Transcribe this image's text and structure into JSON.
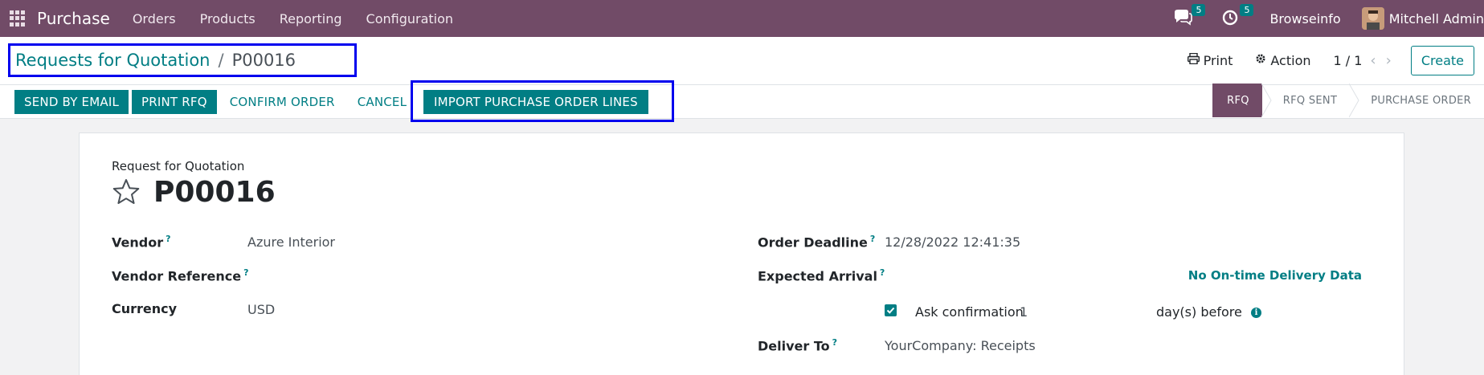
{
  "navbar": {
    "app_name": "Purchase",
    "menus": [
      "Orders",
      "Products",
      "Reporting",
      "Configuration"
    ],
    "messages_count": "5",
    "activities_count": "5",
    "company": "Browseinfo",
    "user": "Mitchell Admin"
  },
  "breadcrumb": {
    "parent": "Requests for Quotation",
    "separator": "/",
    "current": "P00016"
  },
  "control": {
    "print_label": "Print",
    "action_label": "Action",
    "pager": "1 / 1",
    "create_label": "Create"
  },
  "buttons": {
    "send_email": "SEND BY EMAIL",
    "print_rfq": "PRINT RFQ",
    "confirm_order": "CONFIRM ORDER",
    "cancel": "CANCEL",
    "import_lines": "IMPORT PURCHASE ORDER LINES"
  },
  "stages": [
    "RFQ",
    "RFQ SENT",
    "PURCHASE ORDER"
  ],
  "form": {
    "doc_type": "Request for Quotation",
    "doc_name": "P00016",
    "vendor_label": "Vendor",
    "vendor_value": "Azure Interior",
    "vendor_ref_label": "Vendor Reference",
    "currency_label": "Currency",
    "currency_value": "USD",
    "deadline_label": "Order Deadline",
    "deadline_value": "12/28/2022 12:41:35",
    "arrival_label": "Expected Arrival",
    "ontime_text": "No On-time Delivery Data",
    "ask_confirmation_label": "Ask confirmation",
    "ask_confirmation_days": "1",
    "days_before": "day(s) before",
    "deliver_to_label": "Deliver To",
    "deliver_to_value": "YourCompany: Receipts",
    "help_mark": "?"
  },
  "colors": {
    "navbar": "#714B67",
    "primary": "#017e84",
    "highlight_border": "#0000ee"
  }
}
